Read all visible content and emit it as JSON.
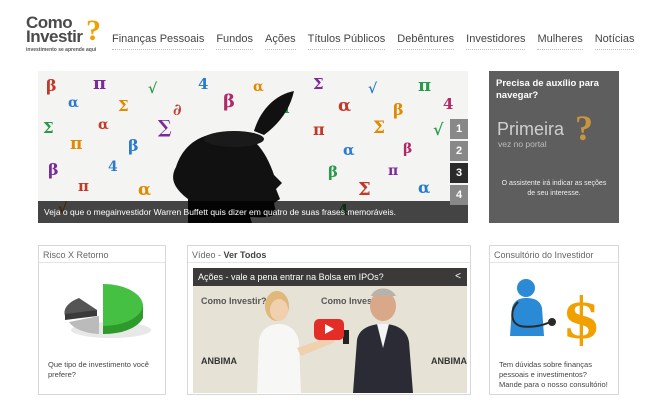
{
  "logo": {
    "line1": "Como",
    "line2": "Investir",
    "tagline": "investimento se aprende aqui"
  },
  "nav": [
    "Finanças Pessoais",
    "Fundos",
    "Ações",
    "Títulos Públicos",
    "Debêntures",
    "Investidores",
    "Mulheres",
    "Notícias"
  ],
  "hero": {
    "caption": "Veja o que o megainvestidor Warren Buffett quis dizer em quatro de suas frases memoráveis.",
    "slides": [
      "1",
      "2",
      "3",
      "4"
    ],
    "active_slide": "3"
  },
  "help": {
    "title": "Precisa de auxílio para navegar?",
    "brand_big": "Primeira",
    "brand_small": "vez no portal",
    "description": "O assistente irá indicar as seções de seu interesse."
  },
  "boxes": {
    "risk": {
      "title": "Risco X Retorno",
      "text": "Que tipo de investimento você prefere?"
    },
    "video": {
      "title_prefix": "Vídeo - ",
      "title_link": "Ver Todos",
      "video_title": "Ações - vale a pena entrar na Bolsa em IPOs?",
      "watermark": "Como Investir?",
      "sponsor": "ANBIMA"
    },
    "consult": {
      "title": "Consultório do Investidor",
      "text": "Tem dúvidas sobre finanças pessoais e investimentos? Mande para o nosso consultório!"
    }
  },
  "colors": {
    "accent": "#f0a000",
    "help_bg": "#5e5e5e",
    "play": "#e52d27",
    "pie_green": "#3db83a"
  }
}
